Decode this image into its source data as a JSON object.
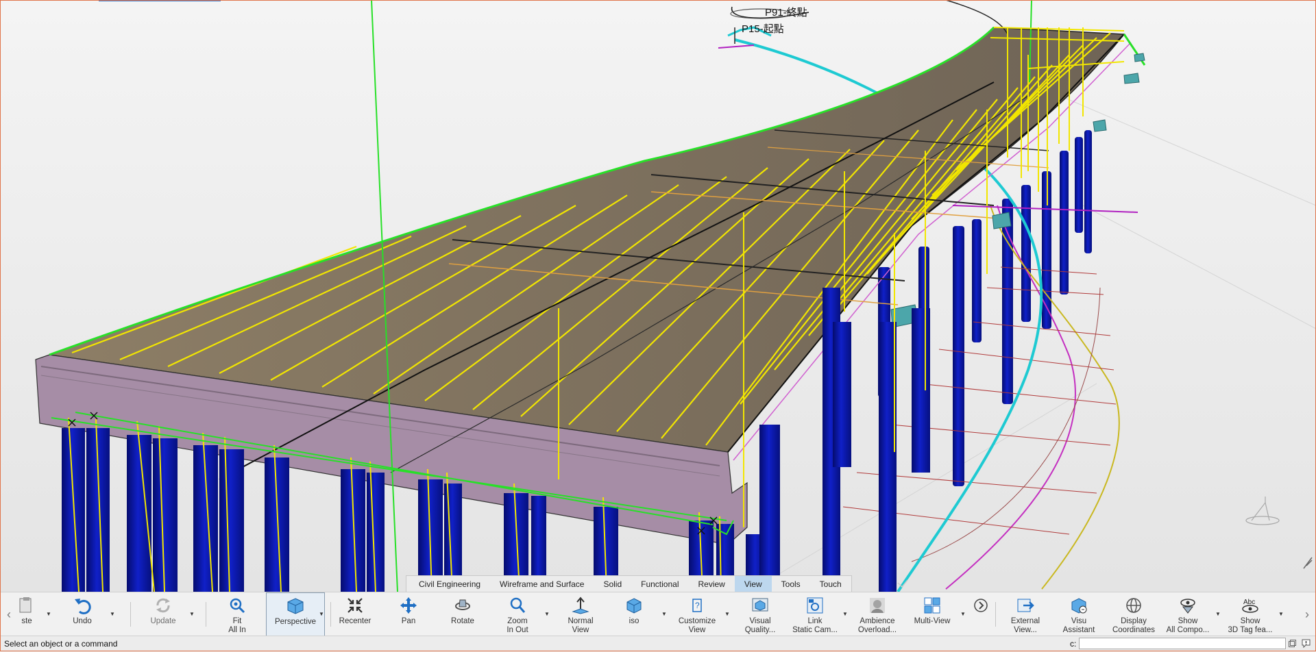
{
  "viewport": {
    "annotations": {
      "end_point": "P91-終點",
      "start_point": "P15-起點"
    }
  },
  "tabs": [
    {
      "label": "Civil Engineering"
    },
    {
      "label": "Wireframe and Surface"
    },
    {
      "label": "Solid"
    },
    {
      "label": "Functional"
    },
    {
      "label": "Review"
    },
    {
      "label": "View",
      "active": true
    },
    {
      "label": "Tools"
    },
    {
      "label": "Touch"
    }
  ],
  "toolbar": {
    "paste": "ste",
    "undo": "Undo",
    "update": "Update",
    "fit_all_in": "Fit\nAll In",
    "perspective": "Perspective",
    "recenter": "Recenter",
    "pan": "Pan",
    "rotate": "Rotate",
    "zoom": "Zoom\nIn Out",
    "normal_view": "Normal\nView",
    "iso": "iso",
    "customize_view": "Customize\nView",
    "visual_quality": "Visual\nQuality...",
    "link_static_camera": "Link\nStatic Cam...",
    "ambience": "Ambience\nOverload...",
    "multi_view": "Multi-View",
    "external_view": "External\nView...",
    "visu_assistant": "Visu\nAssistant",
    "display_coordinates": "Display\nCoordinates",
    "show_all_components": "Show\nAll Compo...",
    "show_3d_tag": "Show\n3D Tag fea..."
  },
  "status": {
    "message": "Select an object or a command",
    "command_label": "c:",
    "command_value": ""
  },
  "colors": {
    "accent": "#bdd7ee",
    "pier": "#0a18b4",
    "deck_edge": "#a68da6",
    "wire_yellow": "#f2e600",
    "wire_green": "#28e028",
    "wire_cyan": "#1ecad2",
    "window_border": "#e0744a"
  }
}
